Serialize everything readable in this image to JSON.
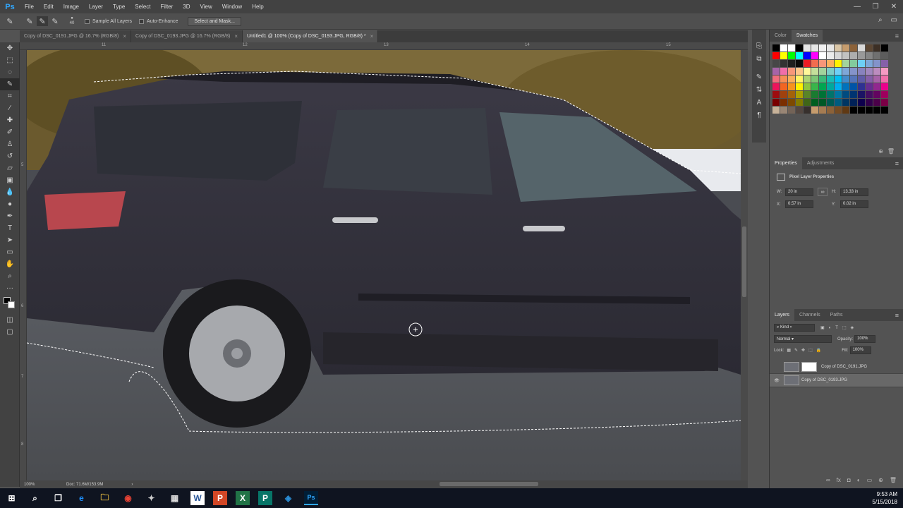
{
  "app": {
    "logo": "Ps"
  },
  "menu": [
    "File",
    "Edit",
    "Image",
    "Layer",
    "Type",
    "Select",
    "Filter",
    "3D",
    "View",
    "Window",
    "Help"
  ],
  "window_buttons": [
    "—",
    "❐",
    "✕"
  ],
  "options": {
    "brush_size": "40",
    "sample_all_layers": "Sample All Layers",
    "auto_enhance": "Auto-Enhance",
    "select_mask": "Select and Mask..."
  },
  "tabs": [
    {
      "label": "Copy of DSC_0191.JPG @ 16.7% (RGB/8)",
      "active": false
    },
    {
      "label": "Copy of DSC_0193.JPG @ 16.7% (RGB/8)",
      "active": false
    },
    {
      "label": "Untitled1 @ 100% (Copy of DSC_0193.JPG, RGB/8) *",
      "active": true
    }
  ],
  "tab_close": "×",
  "ruler": {
    "top": [
      "11",
      "12",
      "13",
      "14",
      "15"
    ],
    "left": [
      "5",
      "6",
      "7",
      "8"
    ]
  },
  "status": {
    "zoom": "100%",
    "doc": "Doc: 71.6M/153.9M",
    "arrow": "›"
  },
  "panels": {
    "color_tabs": [
      "Color",
      "Swatches"
    ],
    "properties_tabs": [
      "Properties",
      "Adjustments"
    ],
    "properties_title": "Pixel Layer Properties",
    "w_label": "W:",
    "w_value": "20 in",
    "h_label": "H:",
    "h_value": "13.33 in",
    "x_label": "X:",
    "x_value": "0.57 in",
    "y_label": "Y:",
    "y_value": "0.02 in",
    "layers_tabs": [
      "Layers",
      "Channels",
      "Paths"
    ],
    "kind": "Kind",
    "blend_mode": "Normal",
    "opacity_label": "Opacity:",
    "opacity_value": "100%",
    "lock_label": "Lock:",
    "fill_label": "Fill:",
    "fill_value": "100%",
    "layers": [
      {
        "name": "Copy of DSC_0191.JPG",
        "visible": false,
        "selected": false,
        "has_mask": true
      },
      {
        "name": "Copy of DSC_0193.JPG",
        "visible": true,
        "selected": true,
        "has_mask": false
      }
    ]
  },
  "swatches": [
    "#000000",
    "#ffffff",
    "#ffffff",
    "#000000",
    "#e6e6e6",
    "#e6e6e6",
    "#f0f0f0",
    "#e6e6e6",
    "#d9c5a6",
    "#c69c6d",
    "#8c6239",
    "#d9d9d9",
    "#5b4633",
    "#3c2f25",
    "#000000",
    "#ff0000",
    "#ffff00",
    "#00ff00",
    "#00ffff",
    "#0000ff",
    "#ff00ff",
    "#ffffff",
    "#ebebeb",
    "#d6d6d6",
    "#c2c2c2",
    "#adadad",
    "#999999",
    "#858585",
    "#707070",
    "#5c5c5c",
    "#474747",
    "#333333",
    "#1f1f1f",
    "#0a0a0a",
    "#ed1c24",
    "#f26c4f",
    "#f69679",
    "#fbaf5d",
    "#fff200",
    "#a3d39c",
    "#82ca9d",
    "#6dcff6",
    "#7da7d9",
    "#8393ca",
    "#8560a8",
    "#a864a8",
    "#f06eaa",
    "#f7977a",
    "#fdc68a",
    "#fff79a",
    "#c4df9b",
    "#a2d39c",
    "#7bcdc8",
    "#6ecff6",
    "#7ea7d8",
    "#8493ca",
    "#8882be",
    "#a187be",
    "#bc8cbf",
    "#f49ac2",
    "#f26d7d",
    "#f68e56",
    "#fbaf5c",
    "#fff467",
    "#acd373",
    "#7cc576",
    "#3bb878",
    "#1abbb4",
    "#00bff3",
    "#438ccb",
    "#5574b9",
    "#605ca8",
    "#855fa8",
    "#a763a8",
    "#f06ea9",
    "#ed145b",
    "#f26522",
    "#f7941d",
    "#fff200",
    "#8dc63f",
    "#39b54a",
    "#00a651",
    "#00a99d",
    "#00aeef",
    "#0072bc",
    "#0054a6",
    "#2e3192",
    "#662d91",
    "#92278f",
    "#ec008c",
    "#9e0b0f",
    "#a0410d",
    "#a36209",
    "#aba000",
    "#598527",
    "#1a7b30",
    "#007236",
    "#00746b",
    "#0076a3",
    "#004b80",
    "#003471",
    "#1b1464",
    "#440e62",
    "#630460",
    "#9e005d",
    "#790000",
    "#7b2e00",
    "#7d4900",
    "#827b00",
    "#406618",
    "#005e20",
    "#005826",
    "#005952",
    "#005b7f",
    "#003663",
    "#002157",
    "#0d004c",
    "#32004b",
    "#4b0049",
    "#7b0046",
    "#c7b299",
    "#998675",
    "#736357",
    "#534741",
    "#37302d",
    "#c69c6d",
    "#a67c52",
    "#8c6239",
    "#754c24",
    "#603913",
    "#000000",
    "#000000",
    "#000000",
    "#000000",
    "#000000"
  ],
  "taskbar": {
    "time": "9:53 AM",
    "date": "5/15/2018",
    "apps": [
      "⊞",
      "⌕",
      "❐",
      "e",
      "🗀",
      "◉",
      "✦",
      "▦",
      "W",
      "P",
      "X",
      "P",
      "◈",
      "Ps"
    ]
  }
}
